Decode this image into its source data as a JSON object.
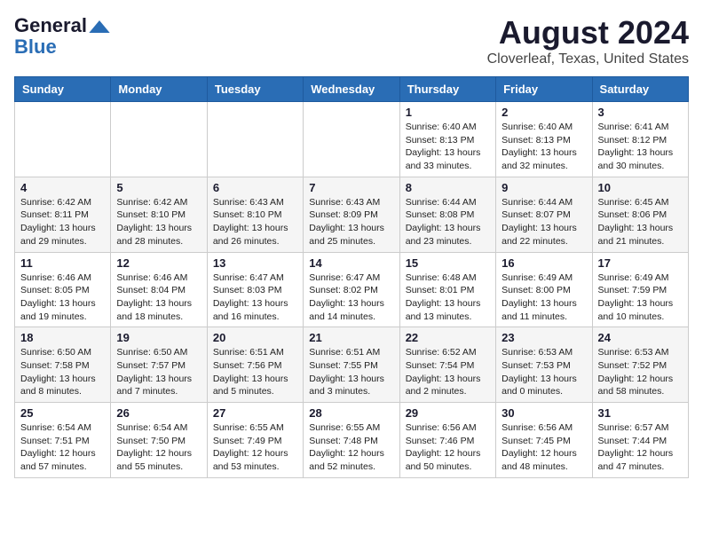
{
  "logo": {
    "line1": "General",
    "line2": "Blue",
    "arrow_color": "#2a6db5"
  },
  "title": "August 2024",
  "location": "Cloverleaf, Texas, United States",
  "days_of_week": [
    "Sunday",
    "Monday",
    "Tuesday",
    "Wednesday",
    "Thursday",
    "Friday",
    "Saturday"
  ],
  "weeks": [
    [
      {
        "day": "",
        "info": ""
      },
      {
        "day": "",
        "info": ""
      },
      {
        "day": "",
        "info": ""
      },
      {
        "day": "",
        "info": ""
      },
      {
        "day": "1",
        "info": "Sunrise: 6:40 AM\nSunset: 8:13 PM\nDaylight: 13 hours\nand 33 minutes."
      },
      {
        "day": "2",
        "info": "Sunrise: 6:40 AM\nSunset: 8:13 PM\nDaylight: 13 hours\nand 32 minutes."
      },
      {
        "day": "3",
        "info": "Sunrise: 6:41 AM\nSunset: 8:12 PM\nDaylight: 13 hours\nand 30 minutes."
      }
    ],
    [
      {
        "day": "4",
        "info": "Sunrise: 6:42 AM\nSunset: 8:11 PM\nDaylight: 13 hours\nand 29 minutes."
      },
      {
        "day": "5",
        "info": "Sunrise: 6:42 AM\nSunset: 8:10 PM\nDaylight: 13 hours\nand 28 minutes."
      },
      {
        "day": "6",
        "info": "Sunrise: 6:43 AM\nSunset: 8:10 PM\nDaylight: 13 hours\nand 26 minutes."
      },
      {
        "day": "7",
        "info": "Sunrise: 6:43 AM\nSunset: 8:09 PM\nDaylight: 13 hours\nand 25 minutes."
      },
      {
        "day": "8",
        "info": "Sunrise: 6:44 AM\nSunset: 8:08 PM\nDaylight: 13 hours\nand 23 minutes."
      },
      {
        "day": "9",
        "info": "Sunrise: 6:44 AM\nSunset: 8:07 PM\nDaylight: 13 hours\nand 22 minutes."
      },
      {
        "day": "10",
        "info": "Sunrise: 6:45 AM\nSunset: 8:06 PM\nDaylight: 13 hours\nand 21 minutes."
      }
    ],
    [
      {
        "day": "11",
        "info": "Sunrise: 6:46 AM\nSunset: 8:05 PM\nDaylight: 13 hours\nand 19 minutes."
      },
      {
        "day": "12",
        "info": "Sunrise: 6:46 AM\nSunset: 8:04 PM\nDaylight: 13 hours\nand 18 minutes."
      },
      {
        "day": "13",
        "info": "Sunrise: 6:47 AM\nSunset: 8:03 PM\nDaylight: 13 hours\nand 16 minutes."
      },
      {
        "day": "14",
        "info": "Sunrise: 6:47 AM\nSunset: 8:02 PM\nDaylight: 13 hours\nand 14 minutes."
      },
      {
        "day": "15",
        "info": "Sunrise: 6:48 AM\nSunset: 8:01 PM\nDaylight: 13 hours\nand 13 minutes."
      },
      {
        "day": "16",
        "info": "Sunrise: 6:49 AM\nSunset: 8:00 PM\nDaylight: 13 hours\nand 11 minutes."
      },
      {
        "day": "17",
        "info": "Sunrise: 6:49 AM\nSunset: 7:59 PM\nDaylight: 13 hours\nand 10 minutes."
      }
    ],
    [
      {
        "day": "18",
        "info": "Sunrise: 6:50 AM\nSunset: 7:58 PM\nDaylight: 13 hours\nand 8 minutes."
      },
      {
        "day": "19",
        "info": "Sunrise: 6:50 AM\nSunset: 7:57 PM\nDaylight: 13 hours\nand 7 minutes."
      },
      {
        "day": "20",
        "info": "Sunrise: 6:51 AM\nSunset: 7:56 PM\nDaylight: 13 hours\nand 5 minutes."
      },
      {
        "day": "21",
        "info": "Sunrise: 6:51 AM\nSunset: 7:55 PM\nDaylight: 13 hours\nand 3 minutes."
      },
      {
        "day": "22",
        "info": "Sunrise: 6:52 AM\nSunset: 7:54 PM\nDaylight: 13 hours\nand 2 minutes."
      },
      {
        "day": "23",
        "info": "Sunrise: 6:53 AM\nSunset: 7:53 PM\nDaylight: 13 hours\nand 0 minutes."
      },
      {
        "day": "24",
        "info": "Sunrise: 6:53 AM\nSunset: 7:52 PM\nDaylight: 12 hours\nand 58 minutes."
      }
    ],
    [
      {
        "day": "25",
        "info": "Sunrise: 6:54 AM\nSunset: 7:51 PM\nDaylight: 12 hours\nand 57 minutes."
      },
      {
        "day": "26",
        "info": "Sunrise: 6:54 AM\nSunset: 7:50 PM\nDaylight: 12 hours\nand 55 minutes."
      },
      {
        "day": "27",
        "info": "Sunrise: 6:55 AM\nSunset: 7:49 PM\nDaylight: 12 hours\nand 53 minutes."
      },
      {
        "day": "28",
        "info": "Sunrise: 6:55 AM\nSunset: 7:48 PM\nDaylight: 12 hours\nand 52 minutes."
      },
      {
        "day": "29",
        "info": "Sunrise: 6:56 AM\nSunset: 7:46 PM\nDaylight: 12 hours\nand 50 minutes."
      },
      {
        "day": "30",
        "info": "Sunrise: 6:56 AM\nSunset: 7:45 PM\nDaylight: 12 hours\nand 48 minutes."
      },
      {
        "day": "31",
        "info": "Sunrise: 6:57 AM\nSunset: 7:44 PM\nDaylight: 12 hours\nand 47 minutes."
      }
    ]
  ]
}
